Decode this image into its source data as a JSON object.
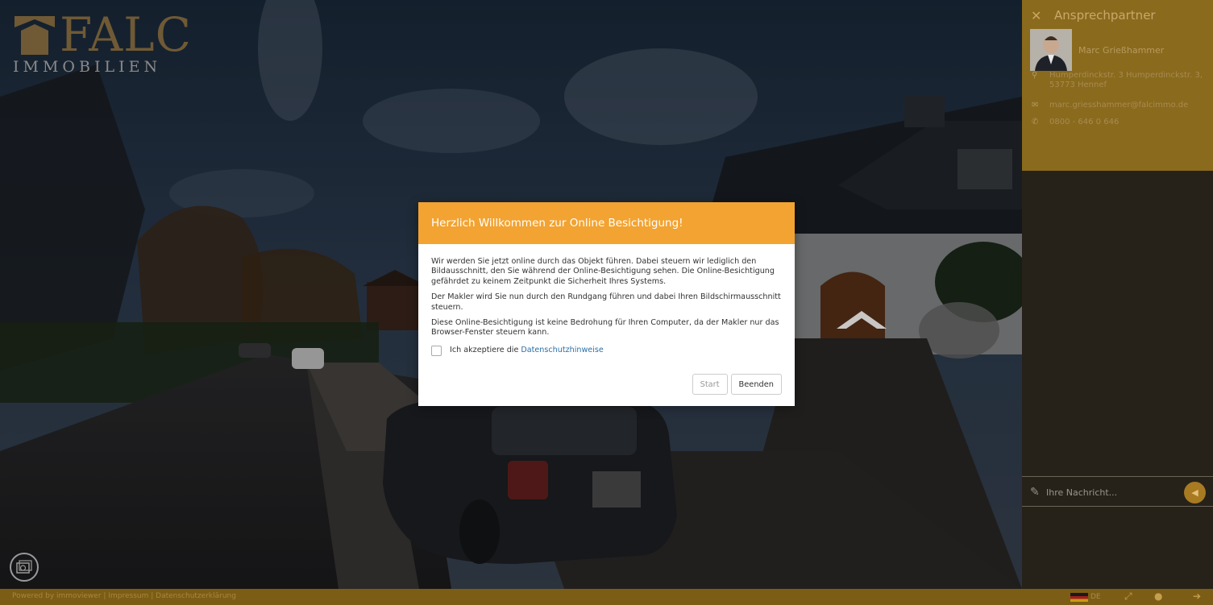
{
  "brand": {
    "name": "FALC",
    "sub": "IMMOBILIEN",
    "color": "#6f5a35"
  },
  "contact": {
    "title": "Ansprechpartner",
    "close_icon": "close-icon",
    "name": "Marc Grießhammer",
    "address": "Humperdinckstr. 3 Humperdinckstr. 3, 53773 Hennef",
    "email": "marc.griesshammer@falcimmo.de",
    "phone": "0800 - 646 0 646"
  },
  "chat": {
    "placeholder": "Ihre Nachricht...",
    "attach_icon": "paperclip-icon",
    "send_icon": "send-icon"
  },
  "modal": {
    "title": "Herzlich Willkommen zur Online Besichtigung!",
    "paragraphs": [
      "Wir werden Sie jetzt online durch das Objekt führen. Dabei steuern wir lediglich den Bildausschnitt, den Sie während der Online-Besichtigung sehen. Die Online-Besichtigung gefährdet zu keinem Zeitpunkt die Sicherheit Ihres Systems.",
      "Der Makler wird Sie nun durch den Rundgang führen und dabei Ihren Bildschirmausschnitt steuern.",
      "Diese Online-Besichtigung ist keine Bedrohung für Ihren Computer, da der Makler nur das Browser-Fenster steuern kann."
    ],
    "accept_text": "Ich akzeptiere die",
    "accept_link": "Datenschutzhinweise",
    "start_label": "Start",
    "end_label": "Beenden"
  },
  "footer": {
    "powered": "Powered by immoviewer",
    "sep": "|",
    "impressum": "Impressum",
    "privacy": "Datenschutzerklärung",
    "lang": "DE"
  },
  "colors": {
    "accent": "#f2a332",
    "footer": "#7c5d15",
    "link": "#2a6fa8"
  }
}
